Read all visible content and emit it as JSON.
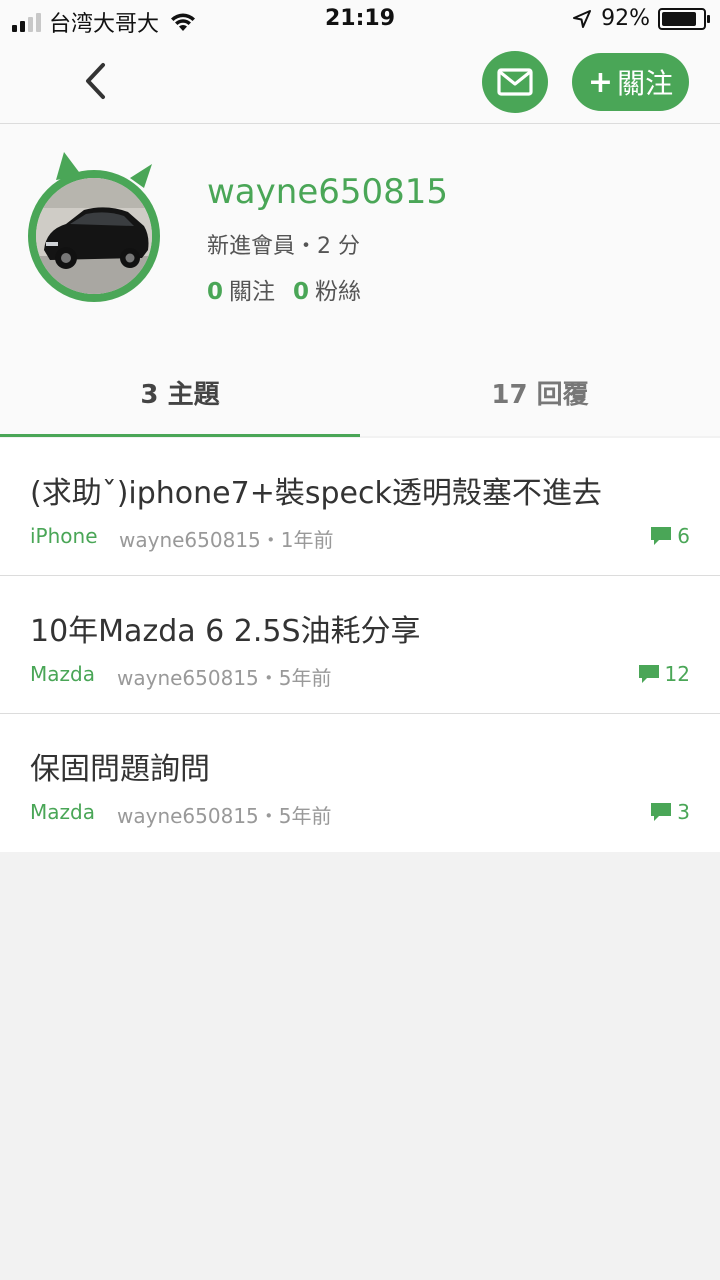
{
  "status_bar": {
    "carrier": "台湾大哥大",
    "time": "21:19",
    "battery": "92%"
  },
  "header": {
    "follow_label": "關注",
    "follow_icon": "plus-icon",
    "mail_icon": "mail-icon",
    "back_icon": "chevron-left-icon"
  },
  "profile": {
    "username": "wayne650815",
    "level": "新進會員・2 分",
    "following_count": "0",
    "following_label": "關注",
    "followers_count": "0",
    "followers_label": "粉絲"
  },
  "tabs": [
    {
      "label": "3 主題",
      "active": true
    },
    {
      "label": "17 回覆",
      "active": false
    }
  ],
  "posts": [
    {
      "title": "(求助ˇ)iphone7+裝speck透明殼塞不進去",
      "tag": "iPhone",
      "meta": "wayne650815・1年前",
      "replies": "6"
    },
    {
      "title": "10年Mazda 6 2.5S油耗分享",
      "tag": "Mazda",
      "meta": "wayne650815・5年前",
      "replies": "12"
    },
    {
      "title": "保固問題詢問",
      "tag": "Mazda",
      "meta": "wayne650815・5年前",
      "replies": "3"
    }
  ],
  "colors": {
    "accent": "#4aa657",
    "background": "#f2f2f2"
  }
}
